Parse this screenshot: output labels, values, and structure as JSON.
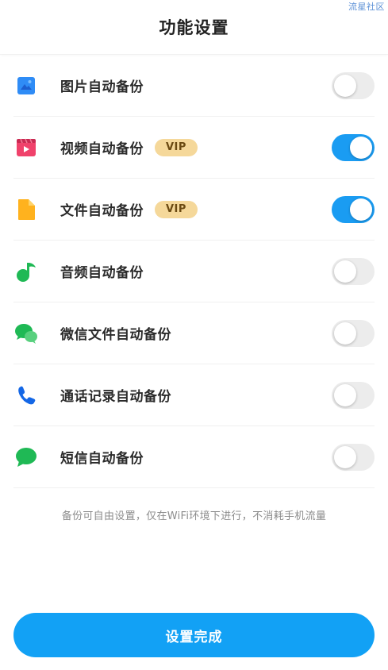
{
  "watermark": "流星社区",
  "header": {
    "title": "功能设置"
  },
  "colors": {
    "accent": "#1A9CF2",
    "button": "#12A1F5",
    "vip_bg": "#F5D89A",
    "switch_off": "#ECECEC"
  },
  "items": [
    {
      "label": "图片自动备份",
      "icon": "image-icon",
      "vip": "",
      "enabled": false
    },
    {
      "label": "视频自动备份",
      "icon": "video-icon",
      "vip": "VIP",
      "enabled": true
    },
    {
      "label": "文件自动备份",
      "icon": "file-icon",
      "vip": "VIP",
      "enabled": true
    },
    {
      "label": "音频自动备份",
      "icon": "music-note-icon",
      "vip": "",
      "enabled": false
    },
    {
      "label": "微信文件自动备份",
      "icon": "wechat-icon",
      "vip": "",
      "enabled": false
    },
    {
      "label": "通话记录自动备份",
      "icon": "phone-icon",
      "vip": "",
      "enabled": false
    },
    {
      "label": "短信自动备份",
      "icon": "sms-bubble-icon",
      "vip": "",
      "enabled": false
    }
  ],
  "note": "备份可自由设置，仅在WiFi环境下进行，不消耗手机流量",
  "footer": {
    "done_label": "设置完成"
  }
}
